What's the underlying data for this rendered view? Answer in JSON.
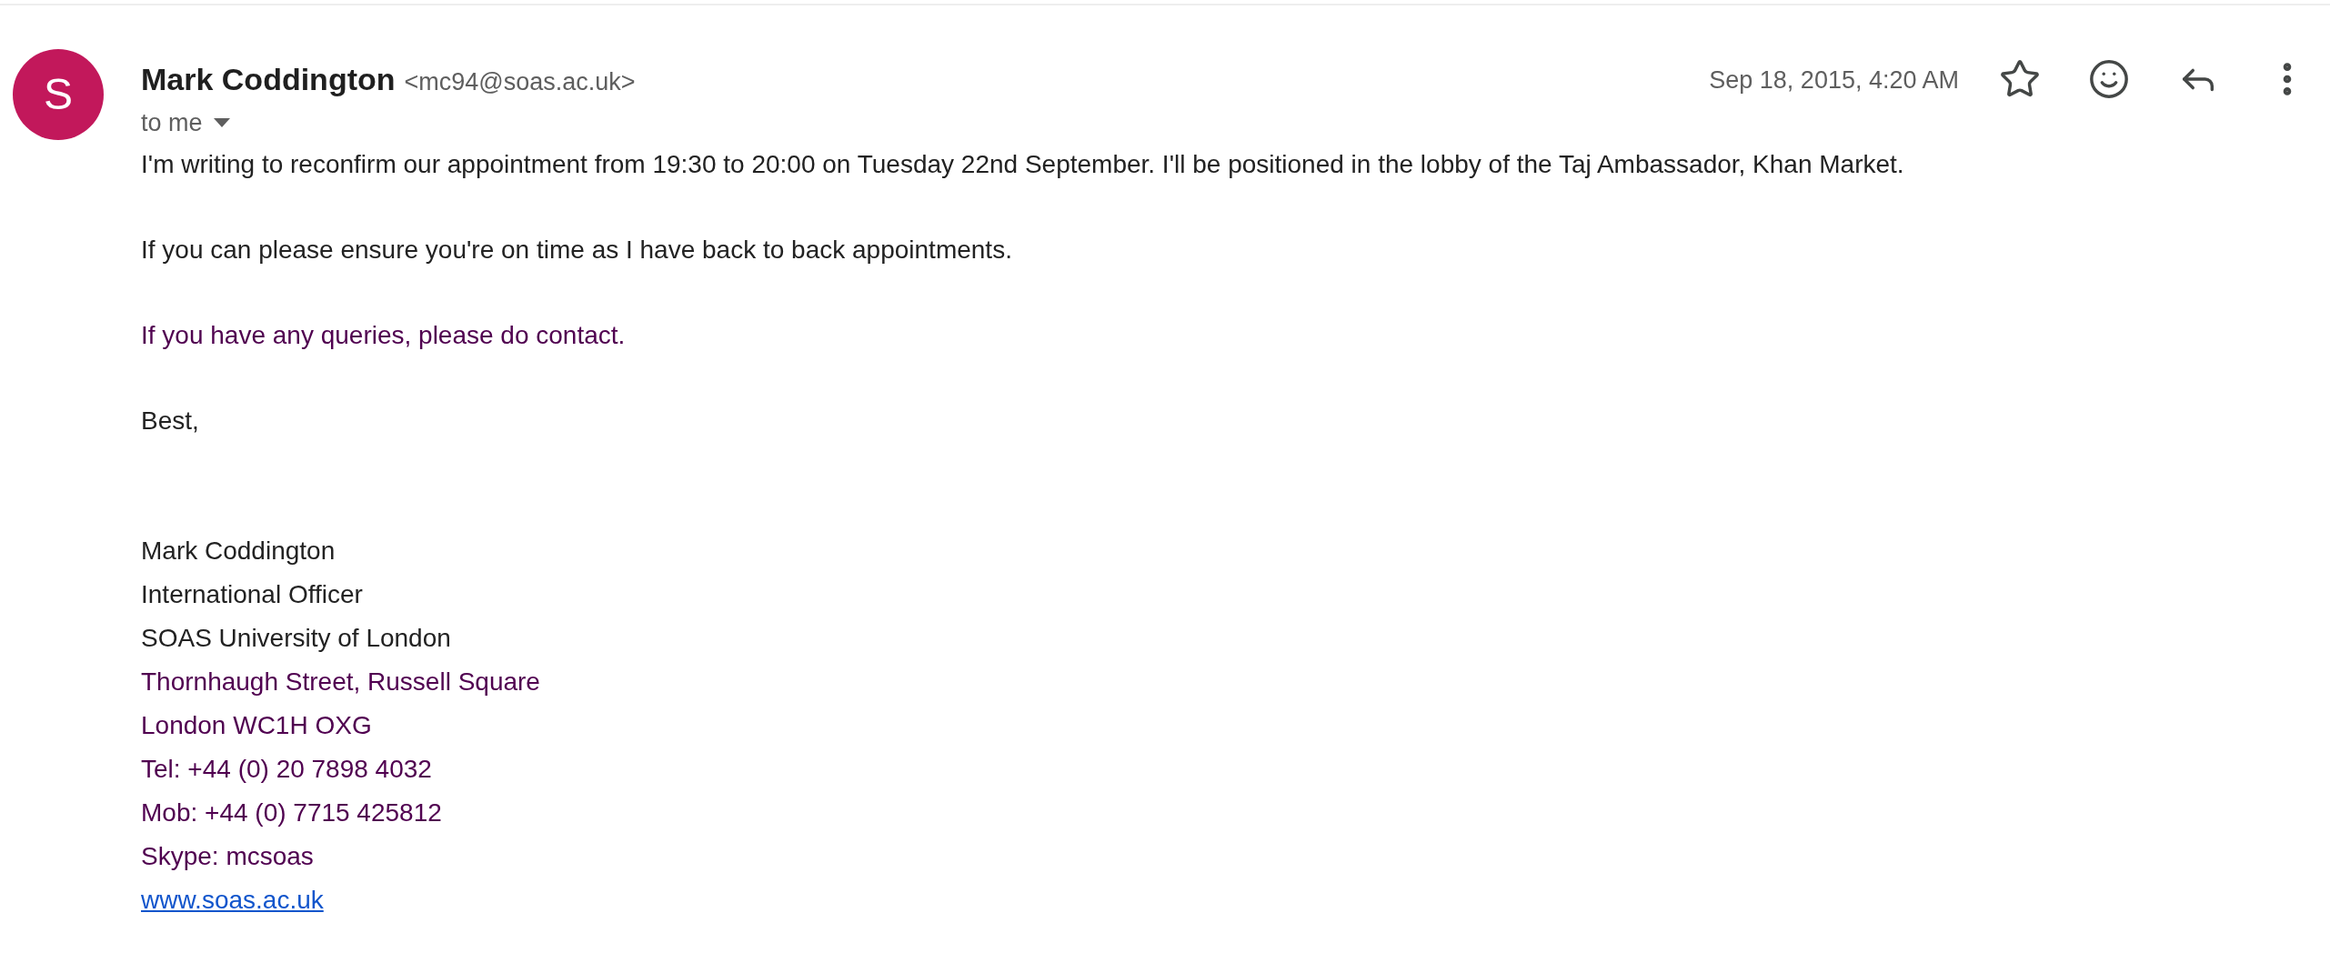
{
  "sender": {
    "avatar_letter": "S",
    "name": "Mark Coddington",
    "email": "<mc94@soas.ac.uk>",
    "recipient": "to me"
  },
  "date": "Sep 18, 2015, 4:20 AM",
  "body": [
    {
      "text": "I'm writing to reconfirm our appointment from 19:30 to 20:00 on Tuesday 22nd September. I'll be positioned in the lobby of the Taj Ambassador, Khan Market.",
      "color": "#222222"
    },
    {
      "text": "If you can please ensure you're on time as I have back to back appointments.",
      "color": "#222222"
    },
    {
      "text": "If you have any queries, please do contact.",
      "color": "#500050"
    },
    {
      "text": "Best,",
      "color": "#222222"
    }
  ],
  "signature": [
    {
      "kind": "text",
      "text": "Mark Coddington",
      "color": "#222222"
    },
    {
      "kind": "text",
      "text": "International Officer",
      "color": "#222222"
    },
    {
      "kind": "text",
      "text": "SOAS University of London",
      "color": "#222222"
    },
    {
      "kind": "text",
      "text": "Thornhaugh Street, Russell Square",
      "color": "#500050"
    },
    {
      "kind": "text",
      "text": "London WC1H OXG",
      "color": "#500050"
    },
    {
      "kind": "text",
      "text": "Tel: +44 (0) 20 7898 4032",
      "color": "#500050"
    },
    {
      "kind": "text",
      "text": "Mob: +44 (0) 7715 425812",
      "color": "#500050"
    },
    {
      "kind": "text",
      "text": "Skype: mcsoas",
      "color": "#500050"
    },
    {
      "kind": "link",
      "text": "www.soas.ac.uk",
      "color": "#1155cc"
    }
  ]
}
